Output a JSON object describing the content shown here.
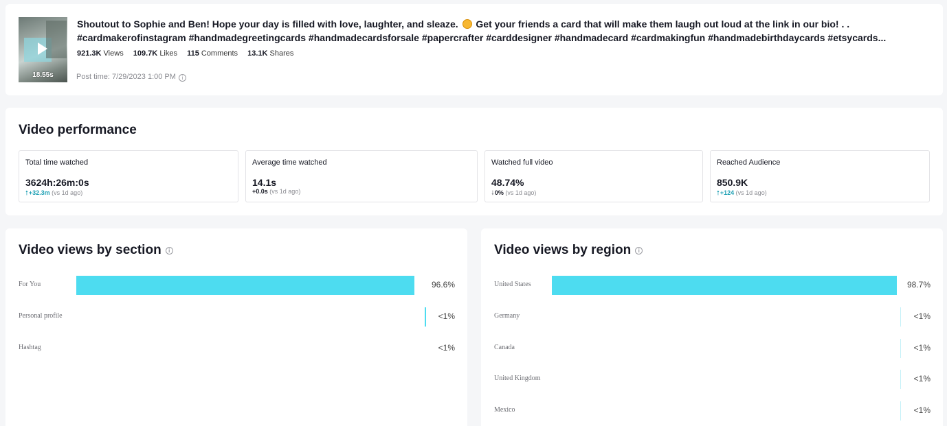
{
  "post": {
    "duration": "18.55s",
    "caption_line1": "Shoutout to Sophie and Ben! Hope your day is filled with love, laughter, and sleaze.",
    "caption_line1b": "Get your friends a card that will make them laugh out loud at the link in our bio!   . .",
    "caption_line2": "#cardmakerofinstagram #handmadegreetingcards #handmadecardsforsale #papercrafter #carddesigner #handmadecard #cardmakingfun #handmadebirthdaycards #etsycards...",
    "stats": [
      {
        "num": "921.3K",
        "label": "Views"
      },
      {
        "num": "109.7K",
        "label": "Likes"
      },
      {
        "num": "115",
        "label": "Comments"
      },
      {
        "num": "13.1K",
        "label": "Shares"
      }
    ],
    "post_time": "Post time: 7/29/2023 1:00 PM"
  },
  "performance": {
    "title": "Video performance",
    "metrics": [
      {
        "label": "Total time watched",
        "value": "3624h:26m:0s",
        "delta": "+32.3m",
        "delta_suffix": "(vs 1d ago)",
        "trend": "up"
      },
      {
        "label": "Average time watched",
        "value": "14.1s",
        "delta": "+0.0s",
        "delta_suffix": "(vs 1d ago)",
        "trend": "flat"
      },
      {
        "label": "Watched full video",
        "value": "48.74%",
        "delta": "0%",
        "delta_suffix": "(vs 1d ago)",
        "trend": "down"
      },
      {
        "label": "Reached Audience",
        "value": "850.9K",
        "delta": "+124",
        "delta_suffix": "(vs 1d ago)",
        "trend": "up"
      }
    ]
  },
  "colors": {
    "bar": "#4ddcf0",
    "delta_up": "#1ea0b4"
  },
  "chart_data": [
    {
      "type": "bar",
      "title": "Video views by section",
      "categories": [
        "For You",
        "Personal profile",
        "Hashtag"
      ],
      "values": [
        96.6,
        0.4,
        0.0
      ],
      "value_labels": [
        "96.6%",
        "<1%",
        "<1%"
      ],
      "xlim": [
        0,
        100
      ],
      "grid": false,
      "legend": "none"
    },
    {
      "type": "bar",
      "title": "Video views by region",
      "categories": [
        "United States",
        "Germany",
        "Canada",
        "United Kingdom",
        "Mexico"
      ],
      "values": [
        98.7,
        0.2,
        0.2,
        0.2,
        0.2
      ],
      "value_labels": [
        "98.7%",
        "<1%",
        "<1%",
        "<1%",
        "<1%"
      ],
      "xlim": [
        0,
        100
      ],
      "grid": false,
      "legend": "none"
    }
  ]
}
